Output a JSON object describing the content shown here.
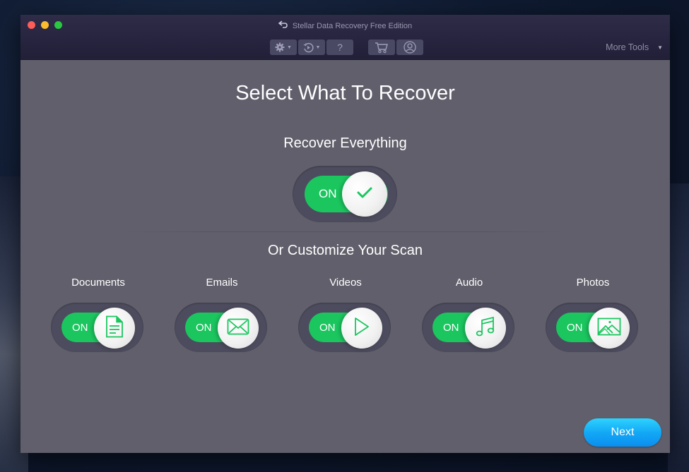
{
  "window": {
    "title": "Stellar Data Recovery Free Edition",
    "traffic_lights": [
      "close",
      "minimize",
      "maximize"
    ]
  },
  "toolbar": {
    "buttons": [
      {
        "name": "settings",
        "icon": "gear-icon",
        "has_dropdown": true
      },
      {
        "name": "history",
        "icon": "history-icon",
        "has_dropdown": true
      },
      {
        "name": "help",
        "icon": "question-icon",
        "label": "?",
        "has_dropdown": false
      },
      {
        "name": "cart",
        "icon": "cart-icon",
        "has_dropdown": false
      },
      {
        "name": "account",
        "icon": "user-icon",
        "has_dropdown": false
      }
    ],
    "more_tools_label": "More Tools"
  },
  "main": {
    "title": "Select What To Recover",
    "recover_everything": {
      "label": "Recover Everything",
      "state_label": "ON",
      "on": true,
      "icon": "check-icon"
    },
    "customize_label": "Or Customize Your Scan",
    "categories": [
      {
        "label": "Documents",
        "state_label": "ON",
        "on": true,
        "icon": "document-icon"
      },
      {
        "label": "Emails",
        "state_label": "ON",
        "on": true,
        "icon": "envelope-icon"
      },
      {
        "label": "Videos",
        "state_label": "ON",
        "on": true,
        "icon": "play-icon"
      },
      {
        "label": "Audio",
        "state_label": "ON",
        "on": true,
        "icon": "music-note-icon"
      },
      {
        "label": "Photos",
        "state_label": "ON",
        "on": true,
        "icon": "image-icon"
      }
    ],
    "next_label": "Next"
  },
  "colors": {
    "toggle_on": "#1bc65f",
    "next_button": "#13a8f5",
    "background": "#605f6b",
    "titlebar": "#272540"
  }
}
